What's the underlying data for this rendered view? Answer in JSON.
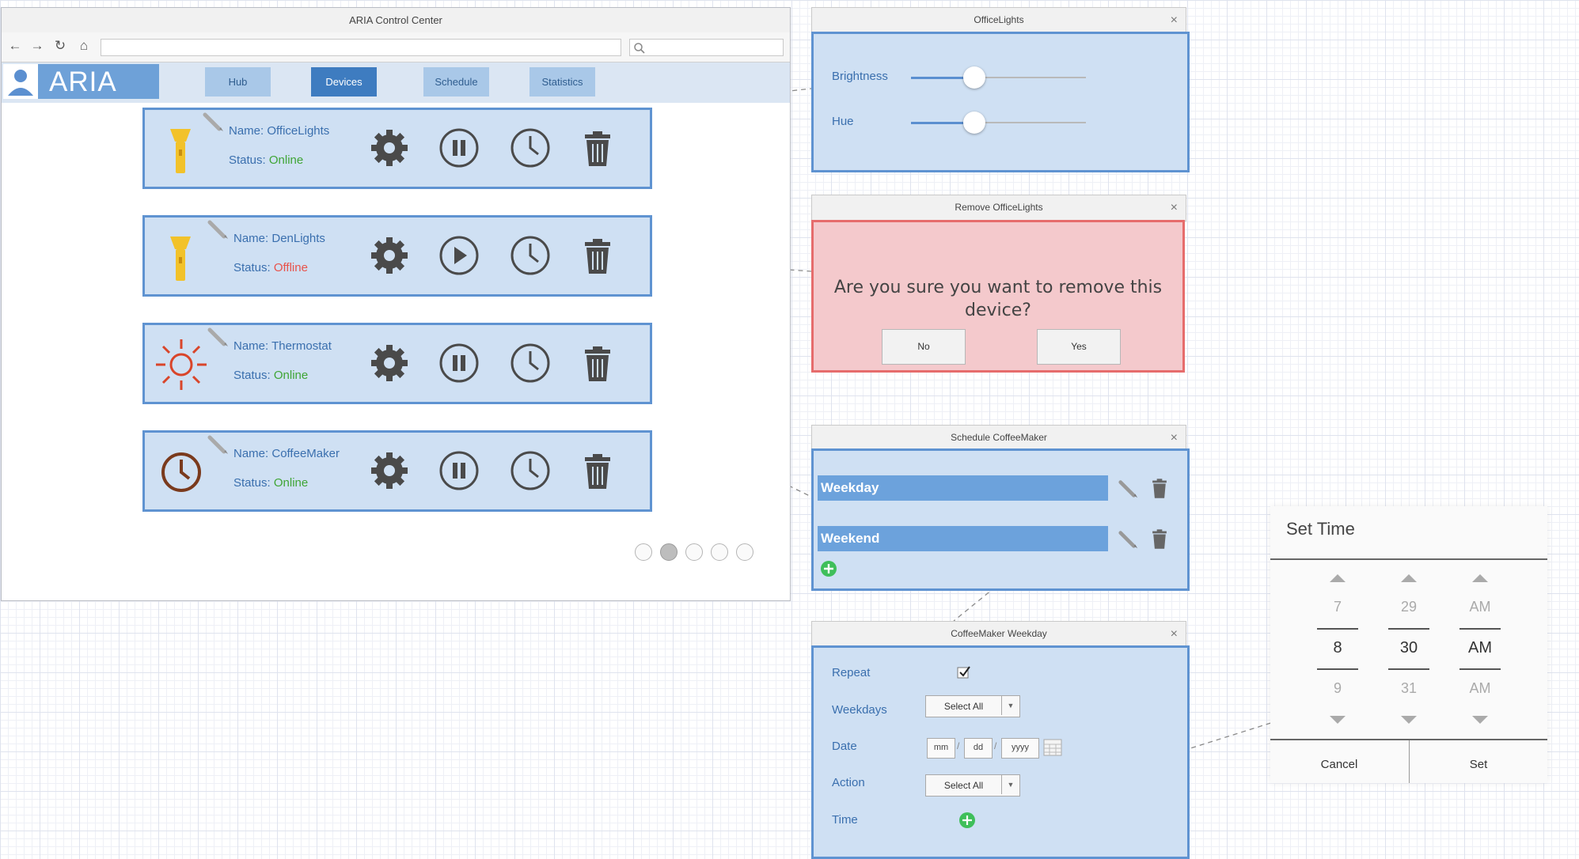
{
  "window": {
    "title": "ARIA Control Center"
  },
  "browser": {
    "back_icon": "arrow-left-icon",
    "forward_icon": "arrow-right-icon",
    "refresh_icon": "refresh-icon",
    "home_icon": "home-icon",
    "search_icon": "search-icon",
    "address": "",
    "search": ""
  },
  "app": {
    "name": "ARIA",
    "brand_color": "#6ea1d8"
  },
  "nav": {
    "tabs": [
      {
        "label": "Hub"
      },
      {
        "label": "Devices",
        "active": true
      },
      {
        "label": "Schedule"
      },
      {
        "label": "Statistics"
      }
    ]
  },
  "devices": [
    {
      "name_prefix": "Name: ",
      "name": "OfficeLights",
      "status_prefix": "Status: ",
      "status": "Online",
      "icon": "flashlight-icon",
      "control": "pause-icon"
    },
    {
      "name_prefix": "Name: ",
      "name": "DenLights",
      "status_prefix": "Status: ",
      "status": "Offline",
      "icon": "flashlight-icon",
      "control": "play-icon"
    },
    {
      "name_prefix": "Name: ",
      "name": "Thermostat",
      "status_prefix": "Status: ",
      "status": "Online",
      "icon": "sun-icon",
      "control": "pause-icon"
    },
    {
      "name_prefix": "Name: ",
      "name": "CoffeeMaker",
      "status_prefix": "Status: ",
      "status": "Online",
      "icon": "clock-icon",
      "control": "pause-icon"
    }
  ],
  "status_colors": {
    "Online": "#3fa535",
    "Offline": "#e8524a"
  },
  "pagination": {
    "pages": 5,
    "current": 2
  },
  "dialogs": {
    "office_lights": {
      "title": "OfficeLights",
      "brightness_label": "Brightness",
      "hue_label": "Hue",
      "brightness_level": 0.36,
      "hue_level": 0.36
    },
    "remove": {
      "title": "Remove OfficeLights",
      "message": "Are you sure you want to remove this device?",
      "no": "No",
      "yes": "Yes"
    },
    "schedule": {
      "title": "Schedule CoffeeMaker",
      "items": [
        "Weekday",
        "Weekend"
      ]
    },
    "weekday": {
      "title": "CoffeeMaker Weekday",
      "repeat_label": "Repeat",
      "repeat_checked": true,
      "weekdays_label": "Weekdays",
      "weekdays_value": "Select All",
      "date_label": "Date",
      "date_mm": "mm",
      "date_dd": "dd",
      "date_yyyy": "yyyy",
      "date_sep": "/",
      "action_label": "Action",
      "action_value": "Select All",
      "time_label": "Time"
    }
  },
  "time_picker": {
    "title": "Set Time",
    "hour": {
      "prev": "7",
      "value": "8",
      "next": "9"
    },
    "minute": {
      "prev": "29",
      "value": "30",
      "next": "31"
    },
    "period": {
      "prev": "AM",
      "value": "AM",
      "next": "AM"
    },
    "cancel": "Cancel",
    "set": "Set"
  }
}
